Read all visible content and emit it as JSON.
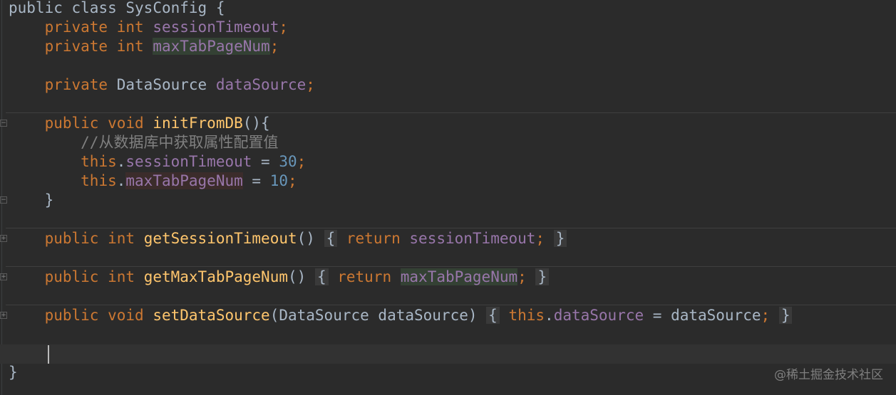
{
  "editor": {
    "lines": {
      "l1_kw1": "public",
      "l1_kw2": "class",
      "l1_name": "SysConfig",
      "l1_brace": "{",
      "l2_kw1": "private",
      "l2_kw2": "int",
      "l2_field": "sessionTimeout",
      "l2_semi": ";",
      "l3_kw1": "private",
      "l3_kw2": "int",
      "l3_field": "maxTabPageNum",
      "l3_semi": ";",
      "l5_kw": "private",
      "l5_type": "DataSource",
      "l5_field": "dataSource",
      "l5_semi": ";",
      "l7_kw1": "public",
      "l7_kw2": "void",
      "l7_method": "initFromDB",
      "l7_paren": "(){",
      "l8_comment": "//从数据库中获取属性配置值",
      "l9_this": "this",
      "l9_dot": ".",
      "l9_field": "sessionTimeout",
      "l9_eq": " = ",
      "l9_num": "30",
      "l9_semi": ";",
      "l10_this": "this",
      "l10_dot": ".",
      "l10_field": "maxTabPageNum",
      "l10_eq": " = ",
      "l10_num": "10",
      "l10_semi": ";",
      "l11_brace": "}",
      "l13_kw1": "public",
      "l13_kw2": "int",
      "l13_method": "getSessionTimeout",
      "l13_paren": "()",
      "l13_ob": "{",
      "l13_ret": "return",
      "l13_field": "sessionTimeout",
      "l13_semi": ";",
      "l13_cb": "}",
      "l15_kw1": "public",
      "l15_kw2": "int",
      "l15_method": "getMaxTabPageNum",
      "l15_paren": "()",
      "l15_ob": "{",
      "l15_ret": "return",
      "l15_field": "maxTabPageNum",
      "l15_semi": ";",
      "l15_cb": "}",
      "l17_kw1": "public",
      "l17_kw2": "void",
      "l17_method": "setDataSource",
      "l17_params": "(DataSource dataSource)",
      "l17_ob": "{",
      "l17_this": "this",
      "l17_dot": ".",
      "l17_field": "dataSource",
      "l17_eq": " = dataSource",
      "l17_semi": ";",
      "l17_cb": "}",
      "l19_brace": "}"
    },
    "watermark": "@稀土掘金技术社区",
    "colors": {
      "background": "#2b2b2b",
      "keyword": "#cc7832",
      "field": "#9876aa",
      "method": "#ffc66d",
      "number": "#6897bb",
      "comment": "#808080",
      "text": "#a9b7c6"
    }
  }
}
